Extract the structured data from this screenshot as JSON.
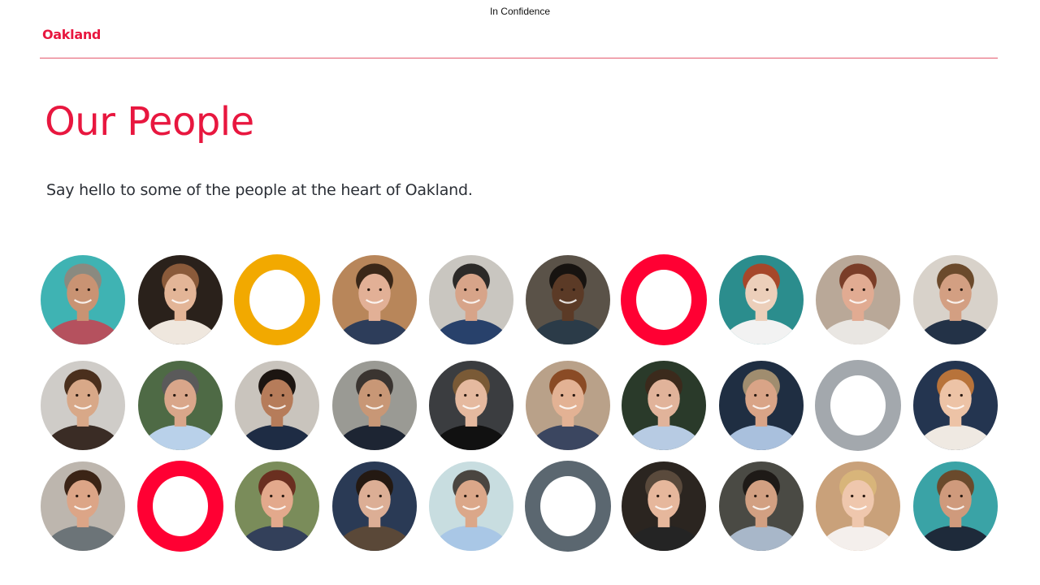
{
  "header": {
    "confidentiality": "In Confidence",
    "logo_text": "Oakland"
  },
  "main": {
    "title": "Our People",
    "subtitle": "Say hello to some of the people at the heart of Oakland."
  },
  "colors": {
    "brand_red": "#e8173f",
    "rule": "#e45a6e",
    "ring_yellow": "#f2a900",
    "ring_red": "#ff0033",
    "ring_grey": "#a3a8ad",
    "ring_slate": "#5b6770"
  },
  "people_grid": {
    "rows": [
      [
        {
          "kind": "photo",
          "bg": "#3fb3b3",
          "skin": "#c99373",
          "hair": "#8a8a80",
          "shirt": "#b5515e"
        },
        {
          "kind": "photo",
          "bg": "#2a211b",
          "skin": "#e3b597",
          "hair": "#8a5a3a",
          "shirt": "#efe7de"
        },
        {
          "kind": "ring",
          "color": "#f2a900"
        },
        {
          "kind": "photo",
          "bg": "#b8865a",
          "skin": "#e2b096",
          "hair": "#3a2718",
          "shirt": "#2d3d5a"
        },
        {
          "kind": "photo",
          "bg": "#c9c6c0",
          "skin": "#d7a489",
          "hair": "#2c2a28",
          "shirt": "#28416b"
        },
        {
          "kind": "photo",
          "bg": "#5a5248",
          "skin": "#5b3a26",
          "hair": "#171310",
          "shirt": "#2b3b48"
        },
        {
          "kind": "ring",
          "color": "#ff0033"
        },
        {
          "kind": "photo",
          "bg": "#2b8d8d",
          "skin": "#eccfba",
          "hair": "#a6472a",
          "shirt": "#f2f2f2"
        },
        {
          "kind": "photo",
          "bg": "#b9a898",
          "skin": "#e1ab92",
          "hair": "#7a3d28",
          "shirt": "#e9e6e2"
        },
        {
          "kind": "photo",
          "bg": "#d8d2ca",
          "skin": "#d39f82",
          "hair": "#6b4a2c",
          "shirt": "#233247"
        }
      ],
      [
        {
          "kind": "photo",
          "bg": "#cfccc8",
          "skin": "#d8a888",
          "hair": "#4a2f1d",
          "shirt": "#3a2c25"
        },
        {
          "kind": "photo",
          "bg": "#4e6a45",
          "skin": "#d9a68a",
          "hair": "#5a5a5a",
          "shirt": "#b9d1ea"
        },
        {
          "kind": "photo",
          "bg": "#c9c4bd",
          "skin": "#b67c5a",
          "hair": "#1c1511",
          "shirt": "#1e2c44"
        },
        {
          "kind": "photo",
          "bg": "#9a9a94",
          "skin": "#c89776",
          "hair": "#3a3430",
          "shirt": "#1d2533"
        },
        {
          "kind": "photo",
          "bg": "#3b3d40",
          "skin": "#e5b99f",
          "hair": "#7a5a36",
          "shirt": "#111111"
        },
        {
          "kind": "photo",
          "bg": "#b9a189",
          "skin": "#e3b294",
          "hair": "#8a4b25",
          "shirt": "#3b4660"
        },
        {
          "kind": "photo",
          "bg": "#2a3a2a",
          "skin": "#e1b39a",
          "hair": "#3b2a1c",
          "shirt": "#b7cbe3"
        },
        {
          "kind": "photo",
          "bg": "#1f2e42",
          "skin": "#d9a487",
          "hair": "#a08d6f",
          "shirt": "#a9c0dd"
        },
        {
          "kind": "ring",
          "color": "#a3a8ad"
        },
        {
          "kind": "photo",
          "bg": "#243550",
          "skin": "#edc3a6",
          "hair": "#b8733a",
          "shirt": "#efe9e2"
        }
      ],
      [
        {
          "kind": "photo",
          "bg": "#bdb6ae",
          "skin": "#dca587",
          "hair": "#3b2416",
          "shirt": "#6c7478"
        },
        {
          "kind": "ring",
          "color": "#ff0033"
        },
        {
          "kind": "photo",
          "bg": "#7a8c5a",
          "skin": "#e3a98c",
          "hair": "#6a2f20",
          "shirt": "#33405a"
        },
        {
          "kind": "photo",
          "bg": "#2a3a55",
          "skin": "#dcae95",
          "hair": "#241912",
          "shirt": "#5a4838"
        },
        {
          "kind": "photo",
          "bg": "#c8dde0",
          "skin": "#dba789",
          "hair": "#4a4540",
          "shirt": "#a9c7e6"
        },
        {
          "kind": "ring",
          "color": "#5b6770"
        },
        {
          "kind": "photo",
          "bg": "#2b2520",
          "skin": "#e6b79c",
          "hair": "#5a4a3c",
          "shirt": "#242424"
        },
        {
          "kind": "photo",
          "bg": "#4a4a44",
          "skin": "#d2a082",
          "hair": "#1e1a17",
          "shirt": "#a8b7c9"
        },
        {
          "kind": "photo",
          "bg": "#c9a17a",
          "skin": "#efc7ad",
          "hair": "#d8b57a",
          "shirt": "#f4efec"
        },
        {
          "kind": "photo",
          "bg": "#3aa3a6",
          "skin": "#cf9a7c",
          "hair": "#6a4a2c",
          "shirt": "#1e2a3a"
        }
      ]
    ]
  }
}
